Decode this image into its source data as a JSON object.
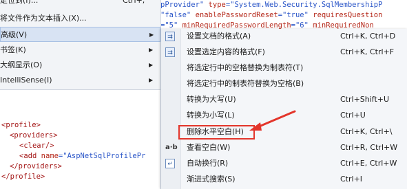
{
  "editor_top": {
    "line1": [
      {
        "t": "pProvider\" ",
        "c": "blue"
      },
      {
        "t": "type",
        "c": "red"
      },
      {
        "t": "=\"System.Web.Security.SqlMembershipP",
        "c": "blue"
      }
    ],
    "line2": [
      {
        "t": "\"false\" ",
        "c": "blue"
      },
      {
        "t": "enablePasswordReset",
        "c": "red"
      },
      {
        "t": "=\"true\" ",
        "c": "blue"
      },
      {
        "t": "requiresQuestion",
        "c": "red"
      }
    ],
    "line3": [
      {
        "t": "=\"5\" ",
        "c": "blue"
      },
      {
        "t": "minRequiredPasswordLength",
        "c": "red"
      },
      {
        "t": "=\"6\" ",
        "c": "blue"
      },
      {
        "t": "minRequiredNon",
        "c": "red"
      }
    ]
  },
  "editor_bottom": {
    "l1": "<profile>",
    "l2": "<providers>",
    "l3": "<clear/>",
    "l4_tag": "<add",
    "l4_attr": "name",
    "l4_val": "=\"AspNetSqlProfilePr",
    "l5": "</providers>",
    "l6": "</profile>"
  },
  "parent_menu": {
    "items": [
      {
        "label": "定位到(I)...",
        "shortcut": "Ctrl+,"
      },
      {
        "label": "将文件作为文本插入(X)...",
        "shortcut": ""
      },
      {
        "label": "高级(V)",
        "shortcut": ""
      },
      {
        "label": "书签(K)",
        "shortcut": ""
      },
      {
        "label": "大纲显示(O)",
        "shortcut": ""
      },
      {
        "label": "IntelliSense(I)",
        "shortcut": ""
      }
    ],
    "submenu_arrow": "▶"
  },
  "submenu": {
    "items": [
      {
        "label": "设置文档的格式(A)",
        "shortcut": "Ctrl+K, Ctrl+D",
        "icon": "format-document-icon",
        "glyph": "⇉"
      },
      {
        "label": "设置选定内容的格式(F)",
        "shortcut": "Ctrl+K, Ctrl+F",
        "icon": "format-selection-icon",
        "glyph": "⇉"
      },
      {
        "label": "将选定行中的空格替换为制表符(T)",
        "shortcut": "",
        "icon": "",
        "glyph": ""
      },
      {
        "label": "将选定行中的制表符替换为空格(B)",
        "shortcut": "",
        "icon": "",
        "glyph": ""
      },
      {
        "label": "转换为大写(U)",
        "shortcut": "Ctrl+Shift+U",
        "icon": "",
        "glyph": ""
      },
      {
        "label": "转换为小写(L)",
        "shortcut": "Ctrl+U",
        "icon": "",
        "glyph": ""
      },
      {
        "label": "删除水平空白(H)",
        "shortcut": "Ctrl+K, Ctrl+\\",
        "icon": "",
        "glyph": ""
      },
      {
        "label": "查看空白(W)",
        "shortcut": "Ctrl+R, Ctrl+W",
        "icon": "view-whitespace-icon",
        "glyph": "a·b"
      },
      {
        "label": "自动换行(R)",
        "shortcut": "Ctrl+E, Ctrl+W",
        "icon": "word-wrap-icon",
        "glyph": "↵"
      },
      {
        "label": "渐进式搜索(S)",
        "shortcut": "Ctrl+I",
        "icon": "",
        "glyph": ""
      }
    ]
  },
  "colors": {
    "annotation": "#e3352b",
    "menu_bg": "#f4f6f9",
    "active_bg": "#d8e3f3"
  }
}
